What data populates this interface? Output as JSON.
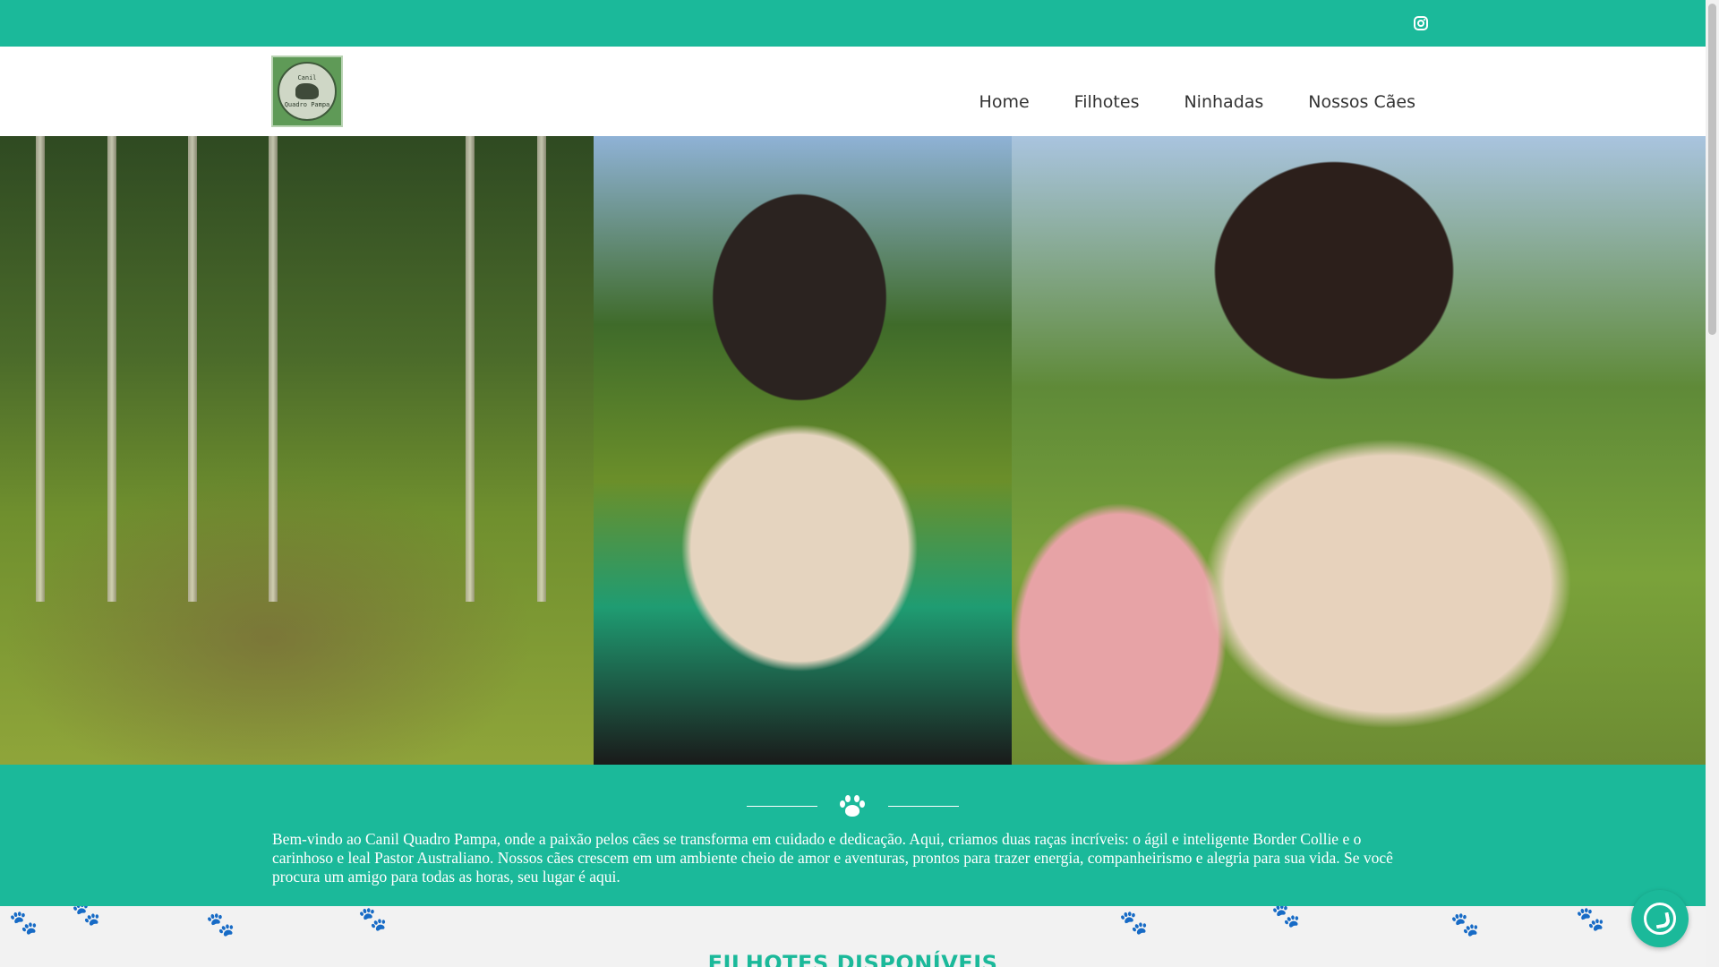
{
  "topbar": {
    "social_icon": "instagram-icon"
  },
  "header": {
    "logo": {
      "line1": "Canil",
      "line2": "Quadro Pampa"
    },
    "nav": [
      "Home",
      "Filhotes",
      "Ninhadas",
      "Nossos Cães"
    ]
  },
  "hero": {
    "photos": [
      "photo-woman-with-dogs",
      "photo-woman-holding-puppies",
      "photo-woman-child-puppies"
    ]
  },
  "intro": {
    "divider_icon": "paw-icon",
    "text": "Bem-vindo ao Canil Quadro Pampa, onde a paixão pelos cães se transforma em cuidado e dedicação. Aqui, criamos duas raças incríveis: o ágil e inteligente Border Collie e o carinhoso e leal Pastor Australiano. Nossos cães crescem em um ambiente cheio de amor e aventuras, prontos para trazer energia, companheirismo e alegria para sua vida. Se você procura um amigo para todas as horas, seu lugar é aqui."
  },
  "section2": {
    "heading": "FILHOTES DISPONÍVEIS"
  },
  "floating": {
    "whatsapp_icon": "whatsapp-icon"
  },
  "colors": {
    "accent": "#1bb99a",
    "nav_text": "#333333",
    "heading": "#1bb99a"
  }
}
